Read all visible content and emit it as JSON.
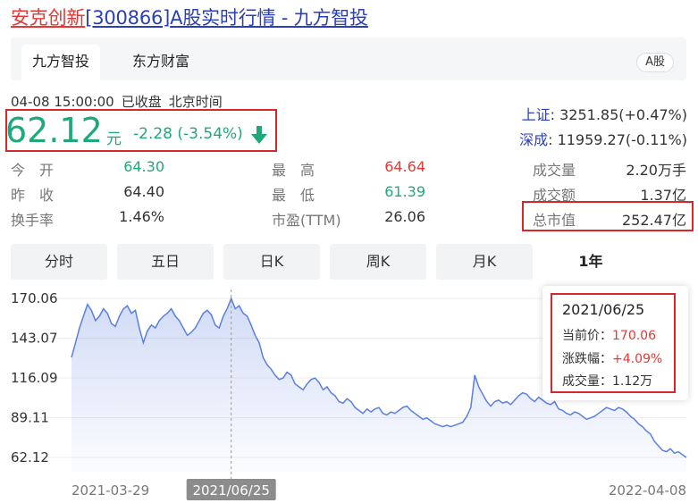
{
  "header": {
    "title_link": "安克创新",
    "title_code": "[300866]",
    "title_rest": "A股实时行情 - 九方智投"
  },
  "tabs": {
    "items": [
      "九方智投",
      "东方财富"
    ],
    "market_badge": "A股"
  },
  "status": {
    "datetime": "04-08 15:00:00",
    "state": "已收盘",
    "zone": "北京时间"
  },
  "quote": {
    "price": "62.12",
    "unit": "元",
    "change": "-2.28 (-3.54%)"
  },
  "indices": [
    {
      "label": "上证",
      "value": ": 3251.85(+0.47%)"
    },
    {
      "label": "深成",
      "value": ": 11959.27(-0.11%)"
    }
  ],
  "stats": {
    "open_label": "今　开",
    "open": "64.30",
    "prev_label": "昨　收",
    "prev": "64.40",
    "turnover_rate_label": "换手率",
    "turnover_rate": "1.46%",
    "high_label": "最　高",
    "high": "64.64",
    "low_label": "最　低",
    "low": "61.39",
    "pe_label": "市盈(TTM)",
    "pe": "26.06",
    "volume_label": "成交量",
    "volume": "2.20万手",
    "amount_label": "成交额",
    "amount": "1.37亿",
    "mktcap_label": "总市值",
    "mktcap": "252.47亿"
  },
  "period_tabs": [
    "分时",
    "五日",
    "日K",
    "周K",
    "月K",
    "1年"
  ],
  "active_period": "1年",
  "colors": {
    "up": "#e53935",
    "down": "#1fa87a",
    "line": "#5b7fe0",
    "link": "#2b3fb8",
    "highlight": "#d62828"
  },
  "chart_data": {
    "type": "area",
    "y_ticks": [
      "170.06",
      "143.07",
      "116.09",
      "89.11",
      "62.12"
    ],
    "ylim": [
      62.12,
      170.06
    ],
    "x_ticks": [
      "2021-03-29",
      "2021/06/25",
      "2022-04-08"
    ],
    "hover_index": 40,
    "values": [
      130,
      140,
      150,
      158,
      166,
      162,
      155,
      158,
      163,
      160,
      153,
      151,
      158,
      163,
      165,
      160,
      162,
      150,
      140,
      148,
      152,
      150,
      155,
      158,
      160,
      163,
      158,
      155,
      150,
      145,
      147,
      150,
      155,
      160,
      162,
      159,
      152,
      150,
      158,
      163,
      170.06,
      163,
      165,
      160,
      158,
      152,
      145,
      140,
      130,
      125,
      122,
      118,
      115,
      116,
      120,
      118,
      112,
      110,
      108,
      112,
      115,
      116,
      113,
      108,
      110,
      106,
      104,
      100,
      99,
      102,
      100,
      96,
      94,
      92,
      95,
      93,
      95,
      96,
      92,
      91,
      93,
      92,
      94,
      96,
      97,
      94,
      92,
      90,
      88,
      89,
      87,
      85,
      84,
      83,
      84,
      83,
      84,
      85,
      86,
      90,
      96,
      118,
      110,
      105,
      100,
      97,
      100,
      101,
      99,
      100,
      98,
      101,
      104,
      106,
      105,
      102,
      100,
      103,
      101,
      99,
      98,
      100,
      95,
      94,
      92,
      91,
      93,
      92,
      90,
      88,
      89,
      90,
      92,
      94,
      96,
      95,
      94,
      96,
      95,
      93,
      90,
      88,
      85,
      83,
      80,
      78,
      73,
      70,
      67,
      66,
      68,
      65,
      66,
      64,
      62.12
    ]
  },
  "tooltip": {
    "date": "2021/06/25",
    "price_label": "当前价：",
    "price": "170.06",
    "change_label": "涨跌幅：",
    "change": "+4.09%",
    "volume_label": "成交量：",
    "volume": "1.12万"
  }
}
